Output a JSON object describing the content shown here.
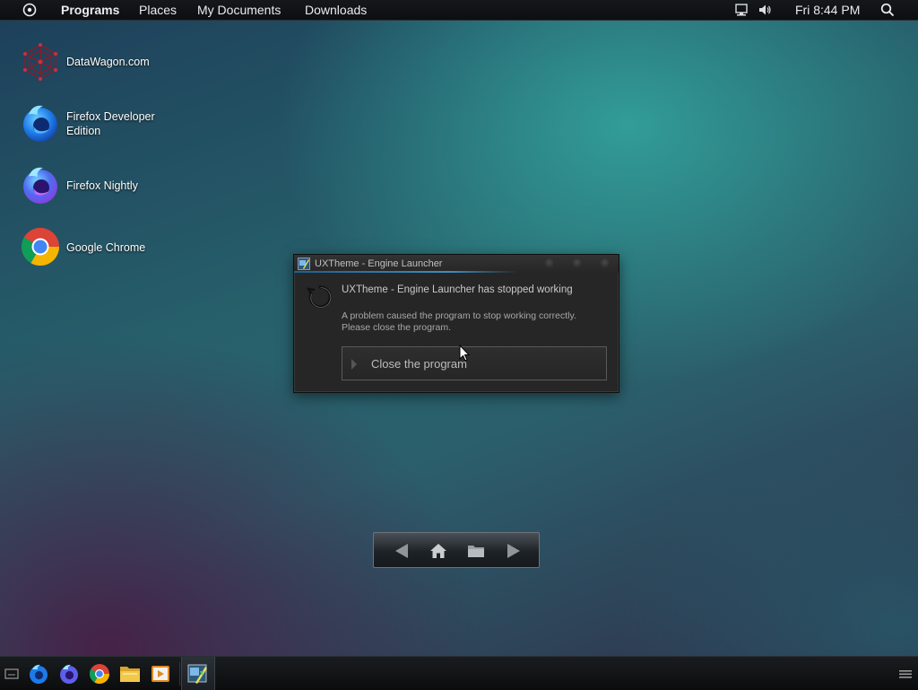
{
  "top_panel": {
    "menus": [
      "Programs",
      "Places",
      "My Documents",
      "Downloads"
    ],
    "clock": "Fri 8:44 PM"
  },
  "desktop_icons": [
    {
      "label": "DataWagon.com",
      "icon": "datawagon-icon"
    },
    {
      "label": "Firefox Developer Edition",
      "icon": "firefox-developer-icon"
    },
    {
      "label": "Firefox Nightly",
      "icon": "firefox-nightly-icon"
    },
    {
      "label": "Google Chrome",
      "icon": "chrome-icon"
    }
  ],
  "dialog": {
    "title": "UXTheme - Engine Launcher",
    "heading": "UXTheme - Engine Launcher has stopped working",
    "body_line1": "A problem caused the program to stop working correctly.",
    "body_line2": "Please close the program.",
    "close_label": "Close the program"
  },
  "dock": {
    "icons": [
      "back-icon",
      "home-icon",
      "folder-icon",
      "forward-icon"
    ]
  },
  "taskbar": {
    "icons": [
      "show-desktop-icon",
      "firefox-developer-icon",
      "firefox-nightly-icon",
      "chrome-icon",
      "file-manager-icon",
      "media-player-icon",
      "uxtheme-app-icon",
      "menu-icon"
    ]
  },
  "colors": {
    "panel_bg": "#0f1113",
    "dialog_bg": "#262626",
    "title_accent": "#3d8fc0"
  }
}
